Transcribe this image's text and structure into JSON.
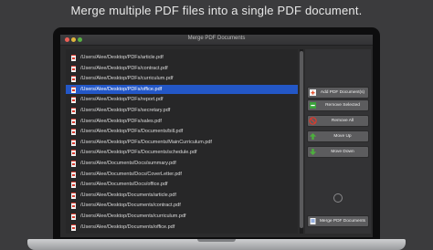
{
  "headline": "Merge multiple PDF files into a single PDF document.",
  "window": {
    "title": "Merge PDF Documents"
  },
  "files": [
    {
      "path": "/Users/Alee/Desktop/PDFs/article.pdf",
      "selected": false
    },
    {
      "path": "/Users/Alee/Desktop/PDFs/contract.pdf",
      "selected": false
    },
    {
      "path": "/Users/Alee/Desktop/PDFs/curriculum.pdf",
      "selected": false
    },
    {
      "path": "/Users/Alee/Desktop/PDFs/office.pdf",
      "selected": true
    },
    {
      "path": "/Users/Alee/Desktop/PDFs/report.pdf",
      "selected": false
    },
    {
      "path": "/Users/Alee/Desktop/PDFs/secretary.pdf",
      "selected": false
    },
    {
      "path": "/Users/Alee/Desktop/PDFs/sales.pdf",
      "selected": false
    },
    {
      "path": "/Users/Alee/Desktop/PDFs/Documents/bill.pdf",
      "selected": false
    },
    {
      "path": "/Users/Alee/Desktop/PDFs/Documents/MainCurriculum.pdf",
      "selected": false
    },
    {
      "path": "/Users/Alee/Desktop/PDFs/Documents/schedule.pdf",
      "selected": false
    },
    {
      "path": "/Users/Alee/Documents/Docs/summary.pdf",
      "selected": false
    },
    {
      "path": "/Users/Alee/Documents/Docs/CoverLetter.pdf",
      "selected": false
    },
    {
      "path": "/Users/Alee/Documents/Docs/office.pdf",
      "selected": false
    },
    {
      "path": "/Users/Alee/Desktop/Documents/article.pdf",
      "selected": false
    },
    {
      "path": "/Users/Alee/Desktop/Documents/contract.pdf",
      "selected": false
    },
    {
      "path": "/Users/Alee/Desktop/Documents/curriculum.pdf",
      "selected": false
    },
    {
      "path": "/Users/Alee/Desktop/Documents/office.pdf",
      "selected": false
    }
  ],
  "buttons": {
    "add": "Add PDF Document(s)",
    "remove_selected": "Remove Selected",
    "remove_all": "Remove All",
    "move_up": "Move Up",
    "move_down": "Move Down",
    "merge": "Merge PDF Documents"
  },
  "colors": {
    "selection": "#2357c7",
    "add_icon": "#e8502c",
    "remove_icon": "#3aa23a",
    "remove_all_icon": "#d63b2f",
    "arrow_icon": "#4caf3c",
    "merge_icon": "#3a6fd0"
  }
}
